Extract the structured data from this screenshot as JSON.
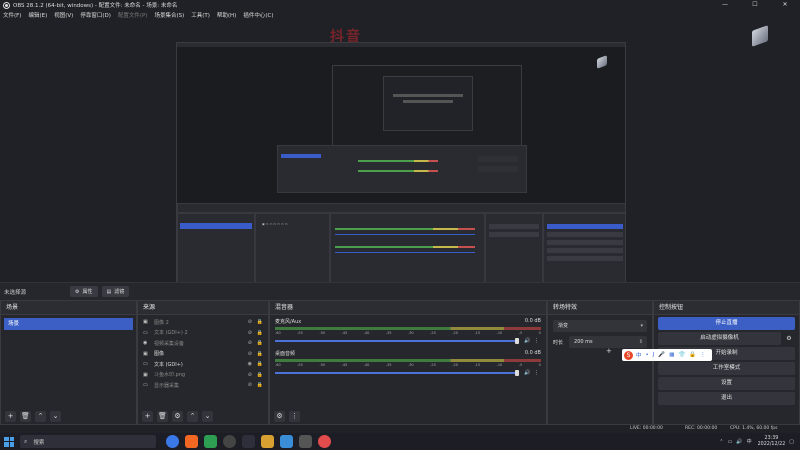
{
  "window": {
    "title": "OBS 28.1.2 (64-bit, windows) - 配置文件: 未命名 - 场景: 未命名",
    "controls": [
      "—",
      "☐",
      "✕"
    ]
  },
  "menu": [
    {
      "label": "文件(F)",
      "enabled": true
    },
    {
      "label": "编辑(E)",
      "enabled": true
    },
    {
      "label": "视图(V)",
      "enabled": true
    },
    {
      "label": "停靠窗口(D)",
      "enabled": true
    },
    {
      "label": "配置文件(P)",
      "enabled": false
    },
    {
      "label": "场景集合(S)",
      "enabled": true
    },
    {
      "label": "工具(T)",
      "enabled": true
    },
    {
      "label": "帮助(H)",
      "enabled": true
    },
    {
      "label": "插件中心(C)",
      "enabled": true
    }
  ],
  "watermark": "抖音 ayaoe",
  "scene_status": {
    "label": "未选择源",
    "properties_label": "属性",
    "filters_label": "滤镜"
  },
  "scenes": {
    "title": "场景",
    "items": [
      "场景"
    ]
  },
  "sources": {
    "title": "来源",
    "items": [
      {
        "icon": "image-icon",
        "label": "图像 2",
        "visible": false,
        "dim": true
      },
      {
        "icon": "text-icon",
        "label": "文本 (GDI+) 2",
        "visible": false,
        "dim": true
      },
      {
        "icon": "camera-icon",
        "label": "视频采集设备",
        "visible": false,
        "dim": true
      },
      {
        "icon": "image-icon",
        "label": "图像",
        "visible": false,
        "dim": false
      },
      {
        "icon": "text-icon",
        "label": "文本 (GDI+)",
        "visible": true,
        "dim": false
      },
      {
        "icon": "image-icon",
        "label": "斗鱼水印.png",
        "visible": false,
        "dim": true
      },
      {
        "icon": "monitor-icon",
        "label": "显示器采集",
        "visible": false,
        "dim": true
      }
    ]
  },
  "mixer": {
    "title": "混音器",
    "channels": [
      {
        "name": "麦克风/Aux",
        "db": "0.0 dB",
        "volume": 1.0
      },
      {
        "name": "桌面音频",
        "db": "0.0 dB",
        "volume": 1.0
      }
    ],
    "ticks": [
      "-60",
      "-55",
      "-50",
      "-45",
      "-40",
      "-35",
      "-30",
      "-25",
      "-20",
      "-15",
      "-10",
      "-5",
      "0"
    ]
  },
  "transitions": {
    "title": "转场特效",
    "selected": "渐变",
    "duration_label": "时长",
    "duration_value": "200 ms"
  },
  "controls": {
    "title": "控制按钮",
    "stop_stream": "停止直播",
    "virtual_cam": "启动虚拟摄像机",
    "start_record": "开始录制",
    "studio_mode": "工作室模式",
    "settings": "设置",
    "exit": "退出"
  },
  "ime": {
    "logo": "S",
    "icons": [
      "中",
      "•",
      "J",
      "🎤",
      "▦",
      "👕",
      "🔒",
      "⋮"
    ]
  },
  "statusbar": {
    "live": "LIVE: 00:00:00",
    "rec": "REC: 00:00:00",
    "cpu": "CPU: 1.4%, 60.00 fps"
  },
  "taskbar": {
    "search_placeholder": "搜索",
    "lang": "中",
    "time": "23:39",
    "date": "2022/12/22"
  },
  "colors": {
    "accent": "#3b5fc5",
    "panel": "#26272c",
    "background": "#1f1f24"
  }
}
